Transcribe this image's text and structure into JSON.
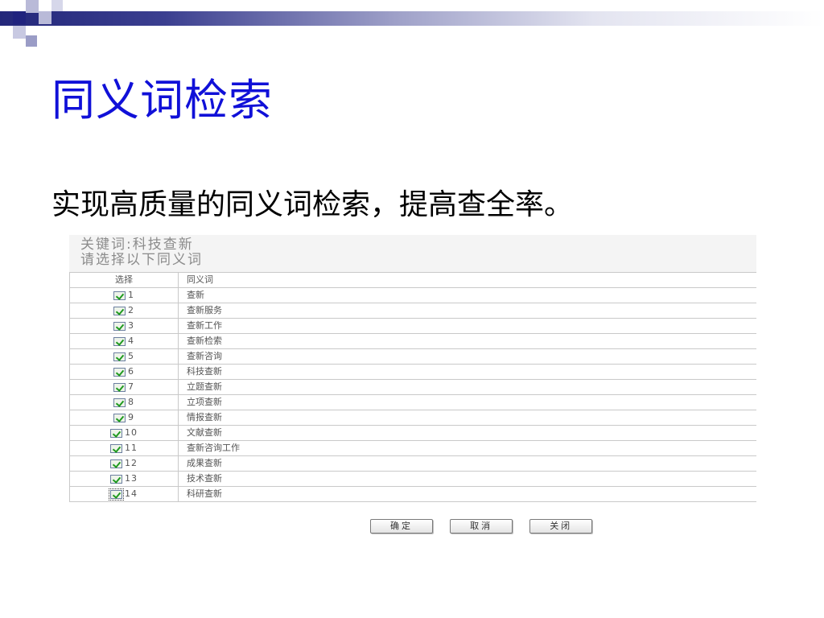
{
  "slide": {
    "title": "同义词检索",
    "subtitle": "实现高质量的同义词检索，提高查全率。",
    "colors": {
      "title": "#1010d8",
      "bar_dark": "#23277a",
      "square_dark": "#20237e",
      "square_light": "#b9bad8"
    }
  },
  "dialog": {
    "keyword_line": "关键词:科技查新",
    "instruction": "请选择以下同义词",
    "header": {
      "select": "选择",
      "synonym": "同义词"
    },
    "rows": [
      {
        "num": "1",
        "word": "查新",
        "checked": true
      },
      {
        "num": "2",
        "word": "查新服务",
        "checked": true
      },
      {
        "num": "3",
        "word": "查新工作",
        "checked": true
      },
      {
        "num": "4",
        "word": "查新检索",
        "checked": true
      },
      {
        "num": "5",
        "word": "查新咨询",
        "checked": true
      },
      {
        "num": "6",
        "word": "科技查新",
        "checked": true
      },
      {
        "num": "7",
        "word": "立题查新",
        "checked": true
      },
      {
        "num": "8",
        "word": "立项查新",
        "checked": true
      },
      {
        "num": "9",
        "word": "情报查新",
        "checked": true
      },
      {
        "num": "10",
        "word": "文献查新",
        "checked": true
      },
      {
        "num": "11",
        "word": "查新咨询工作",
        "checked": true
      },
      {
        "num": "12",
        "word": "成果查新",
        "checked": true
      },
      {
        "num": "13",
        "word": "技术查新",
        "checked": true
      },
      {
        "num": "14",
        "word": "科研查新",
        "checked": true
      }
    ],
    "buttons": {
      "ok": "确定",
      "cancel": "取消",
      "close": "关闭"
    }
  }
}
